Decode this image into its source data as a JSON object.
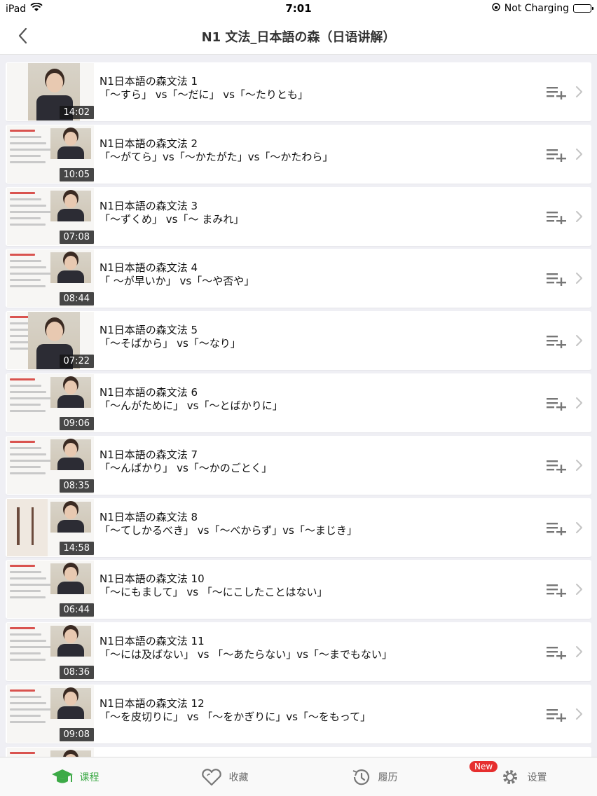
{
  "status_bar": {
    "device": "iPad",
    "time": "7:01",
    "charging": "Not Charging"
  },
  "nav": {
    "title": "N1 文法_日本語の森（日语讲解）"
  },
  "lessons": [
    {
      "title": "N1日本語の森文法 1",
      "subtitle": "「～すら」 vs「～だに」 vs「～たりとも」",
      "duration": "14:02"
    },
    {
      "title": "N1日本語の森文法 2",
      "subtitle": "「～がてら」vs「～かたがた」vs「～かたわら」",
      "duration": "10:05"
    },
    {
      "title": "N1日本語の森文法 3",
      "subtitle": "「～ずくめ」 vs「～ まみれ」",
      "duration": "07:08"
    },
    {
      "title": "N1日本語の森文法 4",
      "subtitle": "「 ～が早いか」 vs「～や否や」",
      "duration": "08:44"
    },
    {
      "title": "N1日本語の森文法 5",
      "subtitle": "「～そばから」 vs「～なり」",
      "duration": "07:22"
    },
    {
      "title": "N1日本語の森文法 6",
      "subtitle": "「～んがために」 vs「～とばかりに」",
      "duration": "09:06"
    },
    {
      "title": "N1日本語の森文法 7",
      "subtitle": "「～んばかり」 vs「～かのごとく」",
      "duration": "08:35"
    },
    {
      "title": "N1日本語の森文法 8",
      "subtitle": "「～てしかるべき」 vs「～べからず」vs「～まじき」",
      "duration": "14:58"
    },
    {
      "title": "N1日本語の森文法 10",
      "subtitle": "「～にもまして」 vs 「～にこしたことはない」",
      "duration": "06:44"
    },
    {
      "title": "N1日本語の森文法 11",
      "subtitle": "「～には及ばない」 vs 「～あたらない」vs「～までもない」",
      "duration": "08:36"
    },
    {
      "title": "N1日本語の森文法 12",
      "subtitle": "「～を皮切りに」 vs 「～をかぎりに」vs「～をもって」",
      "duration": "09:08"
    }
  ],
  "tabs": [
    {
      "label": "课程",
      "icon": "graduation-cap-icon"
    },
    {
      "label": "收藏",
      "icon": "heart-icon"
    },
    {
      "label": "履历",
      "icon": "history-icon"
    },
    {
      "label": "设置",
      "icon": "gear-icon"
    }
  ],
  "settings_badge": "New",
  "colors": {
    "accent": "#3daa47",
    "badge": "#e62e2e",
    "background": "#efeff4"
  }
}
